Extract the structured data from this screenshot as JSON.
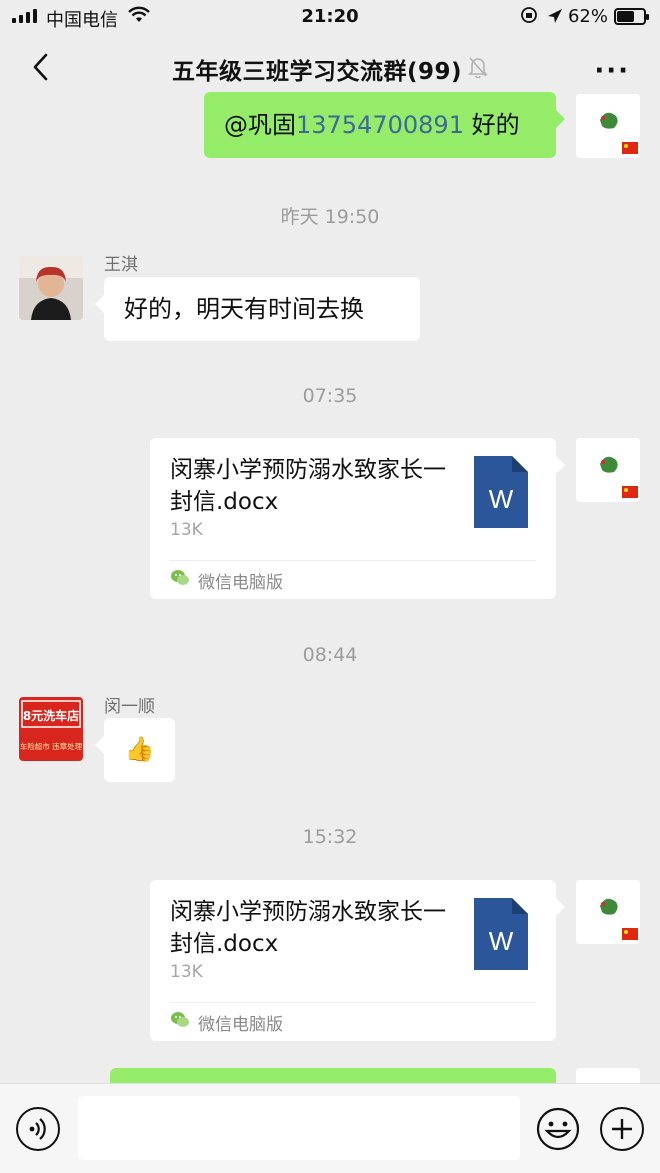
{
  "status_bar": {
    "carrier": "中国电信",
    "time": "21:20",
    "battery_percent": "62%",
    "battery_level": 0.62
  },
  "nav": {
    "title": "五年级三班学习交流群(99)",
    "back_icon": "chevron-left-icon",
    "mute_icon": "bell-off-icon",
    "more_icon": "more-dots-icon"
  },
  "messages": [
    {
      "type": "text",
      "side": "right",
      "prefix": "@巩固",
      "mention": "13754700891",
      "suffix": " 好的"
    },
    {
      "type": "timestamp",
      "text": "昨天 19:50"
    },
    {
      "type": "text",
      "side": "left",
      "sender": "王淇",
      "text": "好的，明天有时间去换"
    },
    {
      "type": "timestamp",
      "text": "07:35"
    },
    {
      "type": "file",
      "side": "right",
      "name": "闵寨小学预防溺水致家长一封信.docx",
      "size": "13K",
      "source": "微信电脑版"
    },
    {
      "type": "timestamp",
      "text": "08:44"
    },
    {
      "type": "emoji",
      "side": "left",
      "sender": "闵一顺",
      "emoji": "👍",
      "avatar_text_top": "8元洗车店",
      "avatar_text_bottom": "车险超市 违章处理"
    },
    {
      "type": "timestamp",
      "text": "15:32"
    },
    {
      "type": "file",
      "side": "right",
      "name": "闵寨小学预防溺水致家长一封信.docx",
      "size": "13K",
      "source": "微信电脑版"
    }
  ],
  "file_icon_letter": "W",
  "colors": {
    "self_bubble": "#95ec69",
    "other_bubble": "#ffffff",
    "background": "#ededed",
    "word_blue": "#2b579a",
    "mention": "#3b6a9a"
  },
  "input_bar": {
    "voice_icon": "voice-icon",
    "emoji_icon": "emoji-icon",
    "plus_icon": "plus-icon",
    "input_value": ""
  }
}
